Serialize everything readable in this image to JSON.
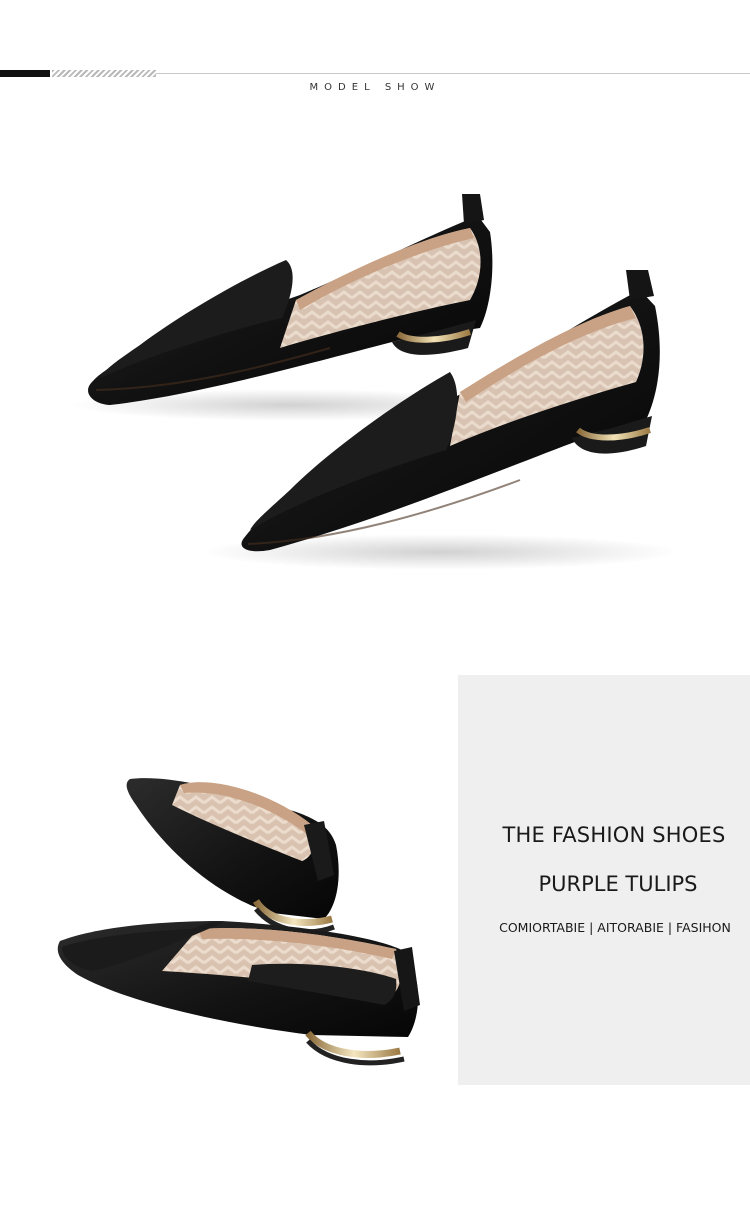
{
  "header": {
    "section_title": "MODEL SHOW"
  },
  "info": {
    "title": "THE FASHION SHOES",
    "subtitle": "PURPLE TULIPS",
    "tags": "COMIORTABIE | AITORABIE | FASIHON"
  },
  "colors": {
    "panel_background": "#efefef",
    "shoe_leather": "#141414",
    "lining": "#c9a184",
    "heel_metal": "#c8a868"
  }
}
